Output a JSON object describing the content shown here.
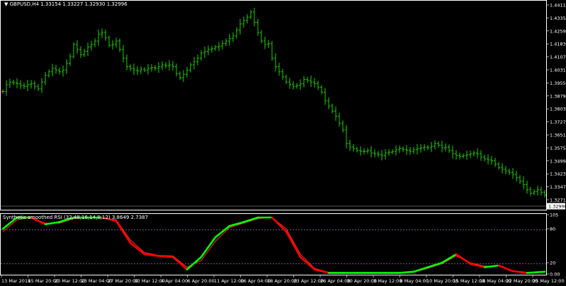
{
  "main_window": {
    "symbol": "GBPUSD,H4",
    "ohlc": "1.33154 1.33227 1.32930 1.32996",
    "current_price": "1.32996",
    "price_labels": [
      "1.44110",
      "1.43350",
      "1.42590",
      "1.41830",
      "1.41070",
      "1.40310",
      "1.39550",
      "1.38790",
      "1.38030",
      "1.37270",
      "1.36510",
      "1.35750",
      "1.34990",
      "1.34230",
      "1.33470",
      "1.32710"
    ]
  },
  "indicator_window": {
    "title": "Synthetic smoothed RSI (32,48,16,14,0,12) 3.8649 2.7387",
    "level_labels": [
      "105",
      "80",
      "20",
      "0.00"
    ],
    "levels": [
      80,
      20
    ]
  },
  "time_labels": [
    "13 Mar 2018",
    "15 Mar 20:00",
    "20 Mar 12:00",
    "23 Mar 04:00",
    "27 Mar 20:00",
    "30 Mar 12:00",
    "4 Apr 04:00",
    "6 Apr 20:00",
    "11 Apr 12:00",
    "16 Apr 04:00",
    "18 Apr 20:00",
    "23 Apr 12:00",
    "26 Apr 04:00",
    "30 Apr 20:00",
    "3 May 12:00",
    "8 May 04:00",
    "10 May 20:00",
    "15 May 12:00",
    "18 May 04:00",
    "22 May 20:00",
    "25 May 12:00"
  ],
  "colors": {
    "background": "#000000",
    "bars": "#22cc00",
    "frame": "#ffffff",
    "rsi_up": "#00ff00",
    "rsi_down": "#ff0000",
    "signal": "#ff3030",
    "level_line": "#a070c0"
  },
  "chart_data": [
    {
      "type": "ohlc",
      "series": [
        {
          "name": "GBPUSD,H4",
          "x": [
            0,
            5,
            10,
            15,
            20,
            25,
            30,
            35,
            40,
            45,
            50,
            55,
            60,
            65,
            70,
            75,
            80,
            85,
            90,
            95,
            100,
            105,
            110,
            115,
            120,
            125,
            130,
            135,
            140,
            145,
            150,
            155,
            160,
            165,
            170,
            175,
            180,
            185,
            190,
            195,
            200,
            205,
            210,
            215,
            220,
            225,
            230,
            235,
            240,
            245,
            250,
            255,
            260,
            265,
            270,
            275,
            280,
            285,
            290,
            295,
            300,
            305,
            310,
            315,
            320,
            325,
            330,
            335,
            340,
            345,
            350,
            355,
            360,
            365,
            370,
            375,
            380,
            385,
            390,
            395,
            400,
            405,
            410,
            415,
            420,
            425,
            430,
            435,
            440,
            445,
            450,
            455,
            460,
            465,
            470,
            475,
            480,
            485,
            490,
            495,
            500,
            505,
            510,
            515,
            520,
            525,
            530,
            535,
            540,
            545,
            550,
            555,
            560,
            565,
            570,
            575,
            580,
            585,
            590,
            595,
            600,
            605,
            610,
            615,
            620,
            625,
            630,
            635,
            640,
            645,
            650,
            655,
            660,
            665,
            670,
            675,
            680,
            685,
            690,
            695,
            700,
            705,
            710,
            715,
            720,
            725,
            730,
            735,
            740,
            745,
            750,
            755,
            760,
            765
          ],
          "close": [
            1.3905,
            1.3945,
            1.396,
            1.3955,
            1.395,
            1.394,
            1.3935,
            1.3945,
            1.395,
            1.3935,
            1.392,
            1.396,
            1.4,
            1.402,
            1.404,
            1.403,
            1.402,
            1.403,
            1.407,
            1.411,
            1.418,
            1.415,
            1.412,
            1.414,
            1.4165,
            1.418,
            1.42,
            1.424,
            1.425,
            1.422,
            1.4175,
            1.418,
            1.42,
            1.415,
            1.41,
            1.405,
            1.404,
            1.403,
            1.4025,
            1.4035,
            1.403,
            1.404,
            1.4045,
            1.404,
            1.405,
            1.406,
            1.4055,
            1.406,
            1.405,
            1.401,
            1.3985,
            1.4005,
            1.403,
            1.406,
            1.408,
            1.41,
            1.413,
            1.414,
            1.415,
            1.4155,
            1.4165,
            1.417,
            1.4185,
            1.42,
            1.4215,
            1.423,
            1.4265,
            1.43,
            1.432,
            1.434,
            1.437,
            1.431,
            1.425,
            1.42,
            1.418,
            1.4185,
            1.41,
            1.405,
            1.402,
            1.399,
            1.396,
            1.3945,
            1.3935,
            1.394,
            1.395,
            1.3975,
            1.397,
            1.396,
            1.395,
            1.393,
            1.39,
            1.385,
            1.382,
            1.379,
            1.376,
            1.372,
            1.368,
            1.36,
            1.358,
            1.357,
            1.356,
            1.3555,
            1.3555,
            1.356,
            1.3545,
            1.354,
            1.3535,
            1.353,
            1.3545,
            1.355,
            1.3555,
            1.3565,
            1.357,
            1.3565,
            1.356,
            1.3555,
            1.3565,
            1.357,
            1.3575,
            1.358,
            1.3575,
            1.3585,
            1.36,
            1.359,
            1.3575,
            1.358,
            1.356,
            1.354,
            1.353,
            1.3525,
            1.353,
            1.3535,
            1.354,
            1.3545,
            1.354,
            1.352,
            1.351,
            1.3505,
            1.35,
            1.348,
            1.346,
            1.345,
            1.344,
            1.343,
            1.342,
            1.34,
            1.338,
            1.336,
            1.333,
            1.331,
            1.332,
            1.333,
            1.3315,
            1.33
          ]
        }
      ]
    },
    {
      "type": "line",
      "title": "Synthetic smoothed RSI (32,48,16,14,0,12) 3.8649 2.7387",
      "ylim": [
        0,
        105
      ],
      "series": [
        {
          "x": [
            0,
            20,
            40,
            60,
            80,
            100,
            120,
            140,
            160,
            180,
            200,
            220,
            240,
            260,
            280,
            300,
            320,
            340,
            360,
            380,
            400,
            420,
            440,
            460,
            480,
            500,
            520,
            540,
            560,
            580,
            600,
            620,
            640,
            660,
            680,
            700,
            720,
            740,
            765
          ],
          "values": [
            80,
            100,
            100,
            88,
            92,
            100,
            100,
            100,
            94,
            55,
            35,
            32,
            30,
            8,
            30,
            65,
            85,
            92,
            100,
            100,
            75,
            30,
            8,
            2,
            2,
            2,
            2,
            2,
            2,
            4,
            12,
            20,
            35,
            18,
            12,
            15,
            5,
            2,
            4
          ]
        },
        {
          "x": [
            0,
            20,
            40,
            60,
            80,
            100,
            120,
            140,
            160,
            180,
            200,
            220,
            240,
            260,
            280,
            300,
            320,
            340,
            360,
            380,
            400,
            420,
            440,
            460,
            480,
            500,
            520,
            540,
            560,
            580,
            600,
            620,
            640,
            660,
            680,
            700,
            720,
            740,
            765
          ],
          "values": [
            75,
            96,
            100,
            90,
            90,
            98,
            100,
            100,
            96,
            60,
            38,
            33,
            32,
            12,
            24,
            58,
            82,
            90,
            98,
            100,
            80,
            35,
            10,
            3,
            2,
            2,
            2,
            2,
            2,
            3,
            10,
            18,
            32,
            20,
            14,
            14,
            6,
            3,
            3
          ]
        }
      ]
    }
  ]
}
